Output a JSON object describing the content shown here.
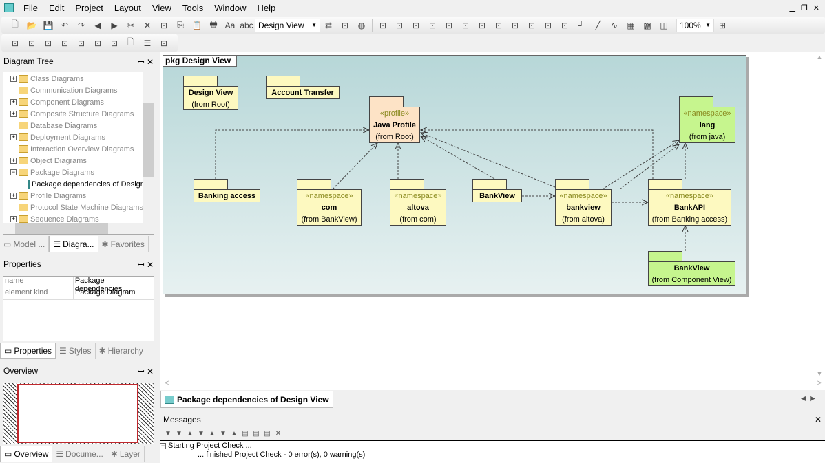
{
  "menu": [
    "File",
    "Edit",
    "Project",
    "Layout",
    "View",
    "Tools",
    "Window",
    "Help"
  ],
  "toolbar1": {
    "icons": [
      "new-icon",
      "open-icon",
      "save-icon",
      "undo-icon",
      "redo-icon",
      "back-icon",
      "forward-icon",
      "cut-icon",
      "delete-icon",
      "copy-image-icon",
      "copy-icon",
      "paste-icon",
      "print-icon",
      "find-icon",
      "find-text-icon"
    ],
    "view_combo": "Design View",
    "icons2": [
      "find-replace-icon",
      "find-in-model-icon",
      "web-icon"
    ],
    "icons3": [
      "align-left-icon",
      "align-center-icon",
      "align-right-icon",
      "align-top-icon",
      "align-middle-icon",
      "align-bottom-icon",
      "same-width-icon",
      "same-height-icon",
      "same-size-icon",
      "space-across-icon",
      "space-down-icon",
      "center-icon",
      "line-orthogonal-icon",
      "line-straight-icon",
      "line-spline-icon",
      "grid-icon",
      "snap-grid-icon",
      "page-icon"
    ],
    "zoom": "100%"
  },
  "toolbar2": {
    "icons": [
      "package-icon",
      "profile-icon",
      "dependency-icon",
      "package-import-icon",
      "element-import-icon",
      "package-merge-icon",
      "profile-application-icon",
      "note-icon",
      "comment-icon",
      "note-link-icon"
    ]
  },
  "diagram_tree": {
    "title": "Diagram Tree",
    "items": [
      {
        "label": "Class Diagrams",
        "exp": "+"
      },
      {
        "label": "Communication Diagrams",
        "exp": ""
      },
      {
        "label": "Component Diagrams",
        "exp": "+"
      },
      {
        "label": "Composite Structure Diagrams",
        "exp": "+"
      },
      {
        "label": "Database Diagrams",
        "exp": ""
      },
      {
        "label": "Deployment Diagrams",
        "exp": "+"
      },
      {
        "label": "Interaction Overview Diagrams",
        "exp": ""
      },
      {
        "label": "Object Diagrams",
        "exp": "+"
      },
      {
        "label": "Package Diagrams",
        "exp": "-"
      },
      {
        "label": "Package dependencies of Design View",
        "exp": "child"
      },
      {
        "label": "Profile Diagrams",
        "exp": "+"
      },
      {
        "label": "Protocol State Machine Diagrams",
        "exp": ""
      },
      {
        "label": "Sequence Diagrams",
        "exp": "+"
      }
    ],
    "tabs": [
      "Model ...",
      "Diagra...",
      "Favorites"
    ]
  },
  "properties": {
    "title": "Properties",
    "rows": [
      [
        "name",
        "Package dependencies"
      ],
      [
        "element kind",
        "Package Diagram"
      ]
    ],
    "tabs": [
      "Properties",
      "Styles",
      "Hierarchy"
    ]
  },
  "overview": {
    "title": "Overview",
    "tabs": [
      "Overview",
      "Docume...",
      "Layer"
    ]
  },
  "diagram": {
    "frame_label": "pkg Design View",
    "packages": {
      "design_view": {
        "name": "Design View",
        "from": "(from Root)"
      },
      "account_transfer": {
        "name": "Account Transfer"
      },
      "java_profile": {
        "stereo": "«profile»",
        "name": "Java Profile",
        "from": "(from Root)"
      },
      "lang": {
        "stereo": "«namespace»",
        "name": "lang",
        "from": "(from java)"
      },
      "banking_access": {
        "name": "Banking access"
      },
      "com": {
        "stereo": "«namespace»",
        "name": "com",
        "from": "(from BankView)"
      },
      "altova": {
        "stereo": "«namespace»",
        "name": "altova",
        "from": "(from com)"
      },
      "bankview_small": {
        "name": "BankView"
      },
      "bankview": {
        "stereo": "«namespace»",
        "name": "bankview",
        "from": "(from altova)"
      },
      "bankapi": {
        "stereo": "«namespace»",
        "name": "BankAPI",
        "from": "(from Banking access)"
      },
      "bankview_comp": {
        "name": "BankView",
        "from": "(from Component View)"
      }
    },
    "colors": {
      "package": "#fdf9c0",
      "profile": "#fde3c6",
      "external": "#c6f58e"
    }
  },
  "doc_tab": "Package dependencies of Design View",
  "messages": {
    "title": "Messages",
    "lines": [
      "Starting Project Check ...",
      "... finished Project Check - 0 error(s), 0 warning(s)"
    ]
  }
}
